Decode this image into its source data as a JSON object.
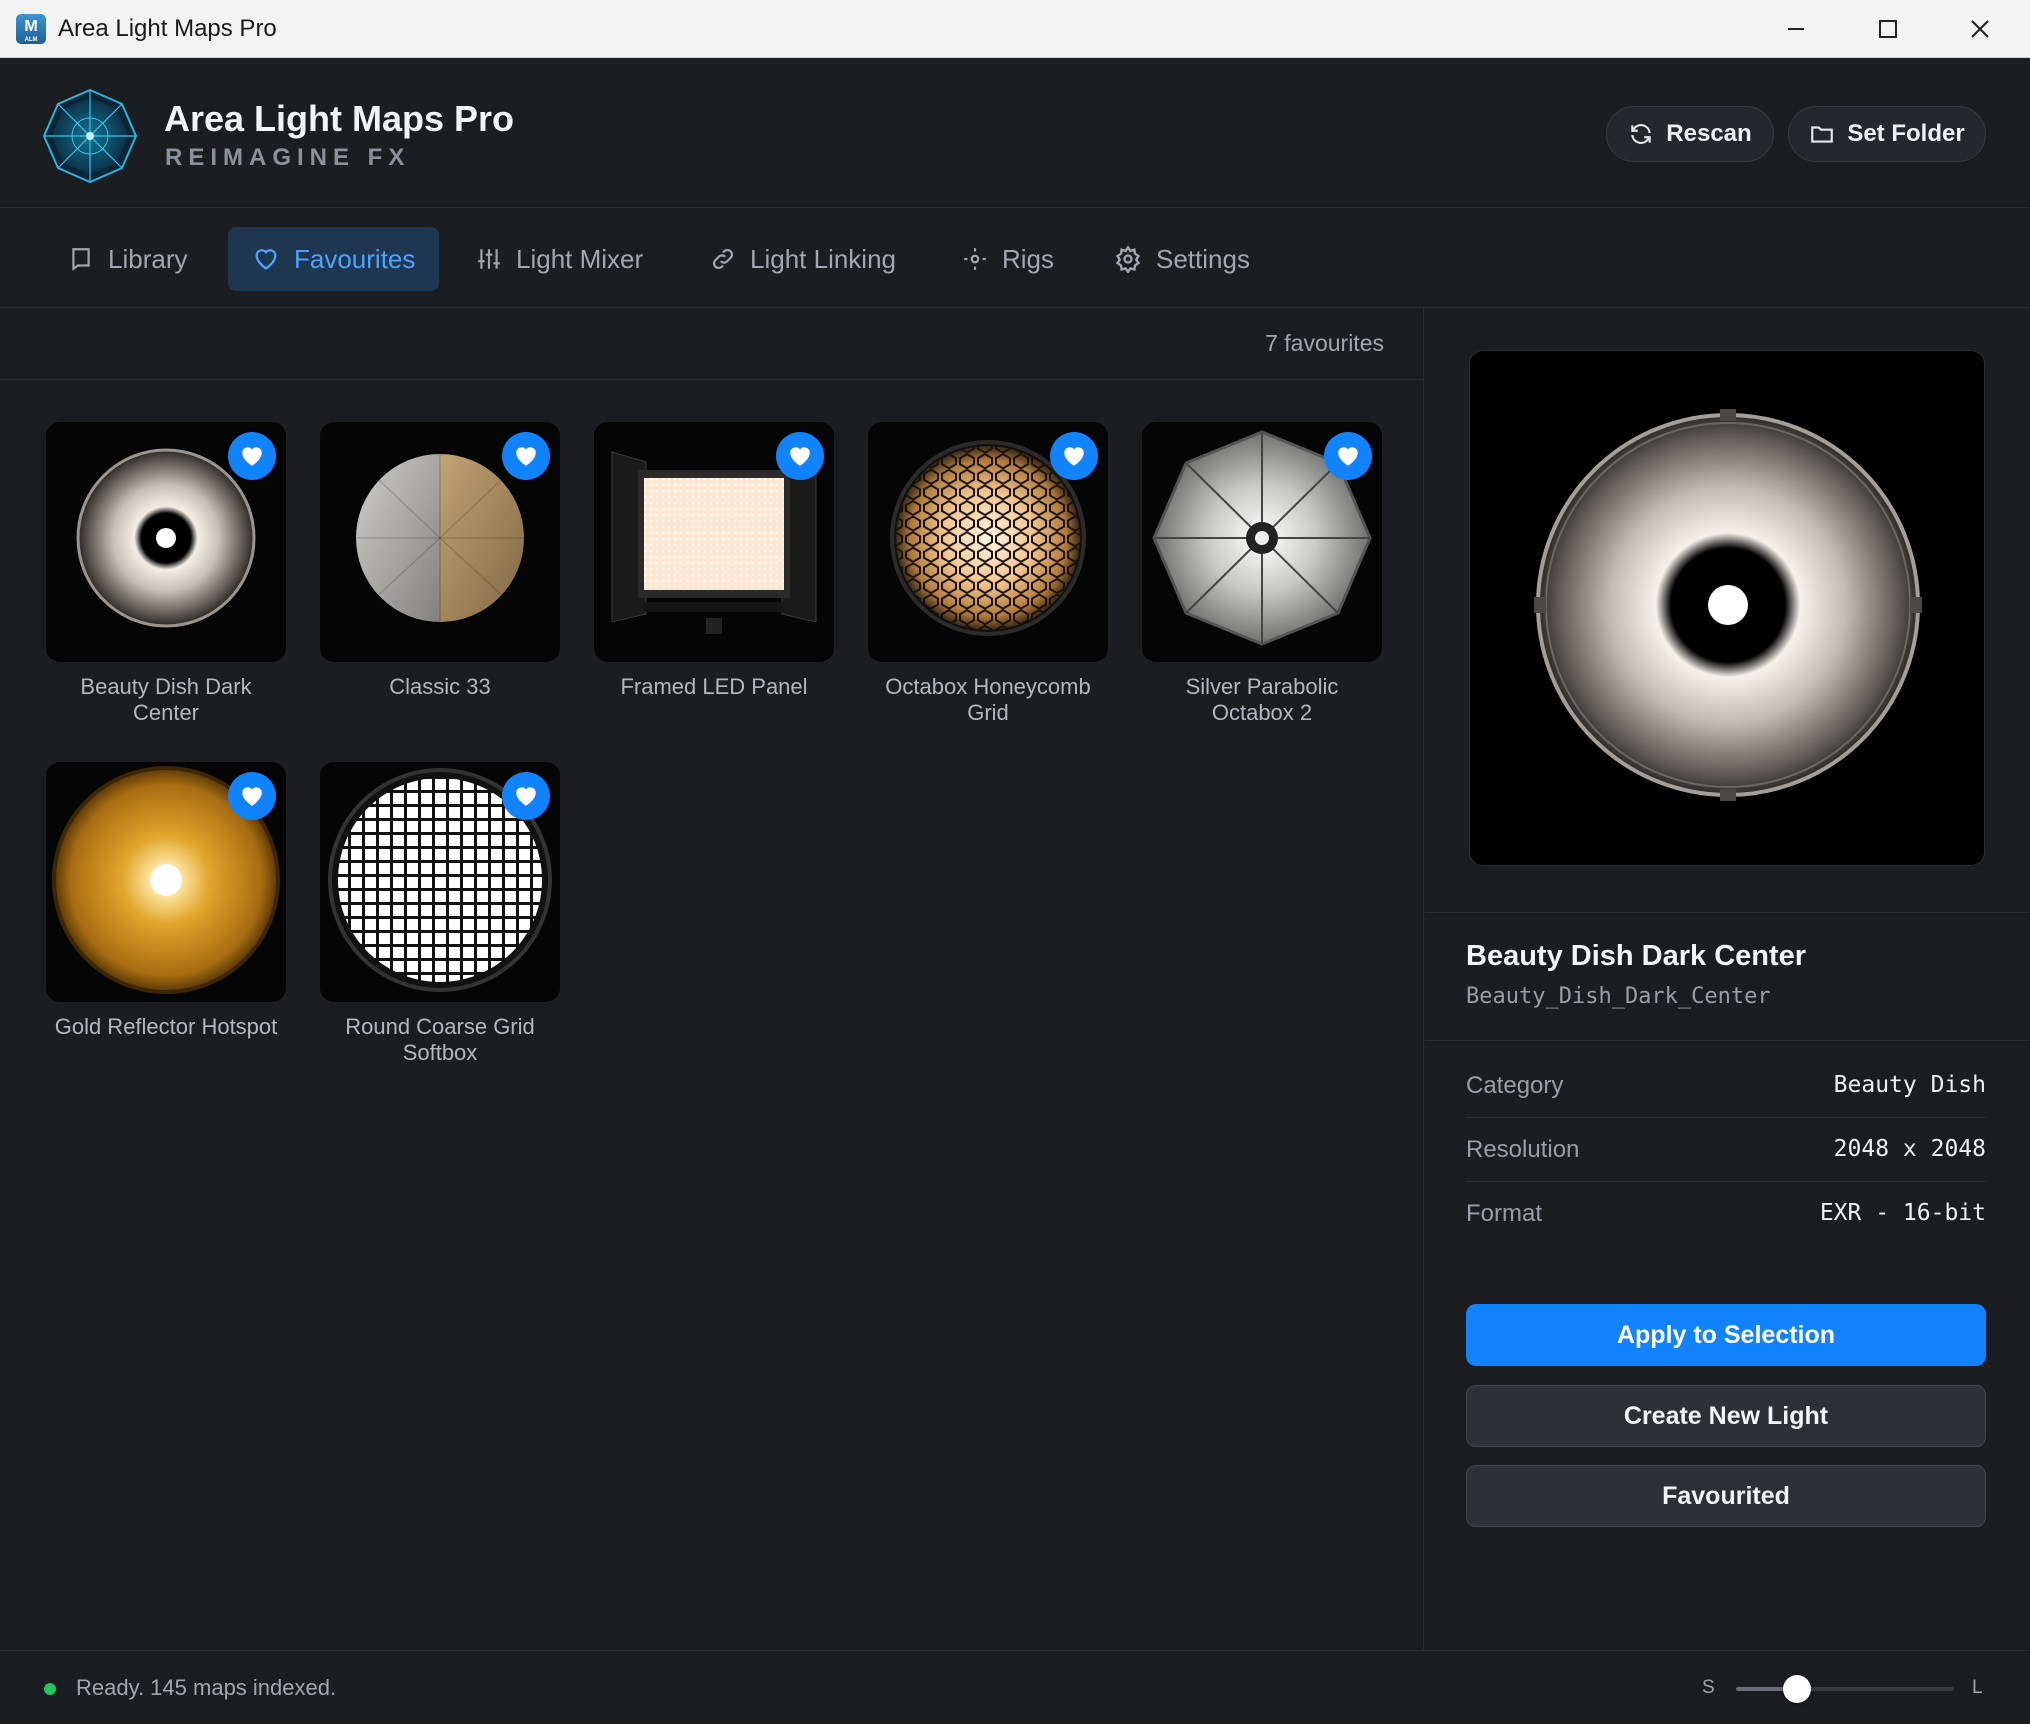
{
  "window": {
    "title": "Area Light Maps Pro",
    "icon_letter": "M",
    "icon_sub": "ALM"
  },
  "header": {
    "brand_title": "Area Light Maps Pro",
    "brand_subtitle": "REIMAGINE FX",
    "rescan_label": "Rescan",
    "set_folder_label": "Set Folder"
  },
  "tabs": [
    {
      "label": "Library",
      "icon": "bookmark-icon"
    },
    {
      "label": "Favourites",
      "icon": "heart-icon"
    },
    {
      "label": "Light Mixer",
      "icon": "sliders-icon"
    },
    {
      "label": "Light Linking",
      "icon": "link-icon"
    },
    {
      "label": "Rigs",
      "icon": "sun-icon"
    },
    {
      "label": "Settings",
      "icon": "gear-icon"
    }
  ],
  "active_tab": "Favourites",
  "main": {
    "count_label": "7 favourites",
    "cards": [
      {
        "label": "Beauty Dish Dark Center",
        "favourited": true
      },
      {
        "label": "Classic 33",
        "favourited": true
      },
      {
        "label": "Framed LED Panel",
        "favourited": true
      },
      {
        "label": "Octabox Honeycomb Grid",
        "favourited": true
      },
      {
        "label": "Silver Parabolic Octabox 2",
        "favourited": true
      },
      {
        "label": "Gold Reflector Hotspot",
        "favourited": true
      },
      {
        "label": "Round Coarse Grid Softbox",
        "favourited": true
      }
    ]
  },
  "panel": {
    "selected_name": "Beauty Dish Dark Center",
    "selected_file": "Beauty_Dish_Dark_Center",
    "props": [
      {
        "key": "Category",
        "value": "Beauty Dish"
      },
      {
        "key": "Resolution",
        "value": "2048 x 2048"
      },
      {
        "key": "Format",
        "value": "EXR - 16-bit"
      }
    ],
    "apply_label": "Apply to Selection",
    "create_label": "Create New Light",
    "favourited_label": "Favourited"
  },
  "status": {
    "text": "Ready. 145 maps indexed.",
    "size_small": "S",
    "size_large": "L",
    "thumb_size_fraction": 0.28
  },
  "colors": {
    "accent": "#1283ff",
    "active_tab_bg": "#1f3650",
    "status_ok": "#22c55e"
  }
}
